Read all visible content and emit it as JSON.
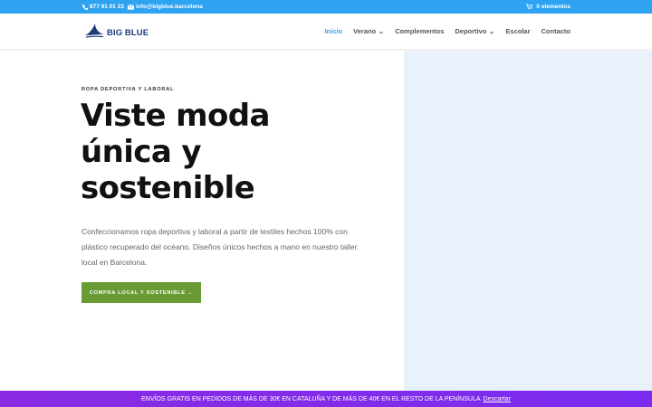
{
  "topbar": {
    "phone": "877 91 01 23",
    "email": "info@bigblue.barcelona",
    "cart": "0 elementos",
    "bg_color": "#2ea3f2"
  },
  "header": {
    "logo_text": "BIG BLUE",
    "nav": [
      {
        "label": "Inicio",
        "active": true,
        "dropdown": false
      },
      {
        "label": "Verano",
        "active": false,
        "dropdown": true
      },
      {
        "label": "Complementos",
        "active": false,
        "dropdown": false
      },
      {
        "label": "Deportivo",
        "active": false,
        "dropdown": true
      },
      {
        "label": "Escolar",
        "active": false,
        "dropdown": false
      },
      {
        "label": "Contacto",
        "active": false,
        "dropdown": false
      }
    ],
    "accent_color": "#2ea3f2"
  },
  "hero": {
    "eyebrow": "ROPA DEPORTIVA Y LABORAL",
    "headline_line1": "Viste moda",
    "headline_line2": "única y",
    "headline_line3": "sostenible",
    "lead": "Confeccionamos ropa deportiva y laboral a partir de textiles hechos 100% con plástico recuperado del océano. Diseños únicos hechos a mano en nuestro taller local en Barcelona.",
    "cta_label": "COMPRA LOCAL Y SOSTENIBLE →",
    "cta_color": "#689b33",
    "panel_color": "#e9f1fb"
  },
  "promo": {
    "text": "ENVÍOS GRATIS EN PEDIDOS DE MÁS DE 30€ EN CATALUÑA Y DE MÁS DE 40€ EN EL RESTO DE LA PENÍNSULA",
    "dismiss_label": "Descartar",
    "bg_color": "#8a2be2"
  }
}
